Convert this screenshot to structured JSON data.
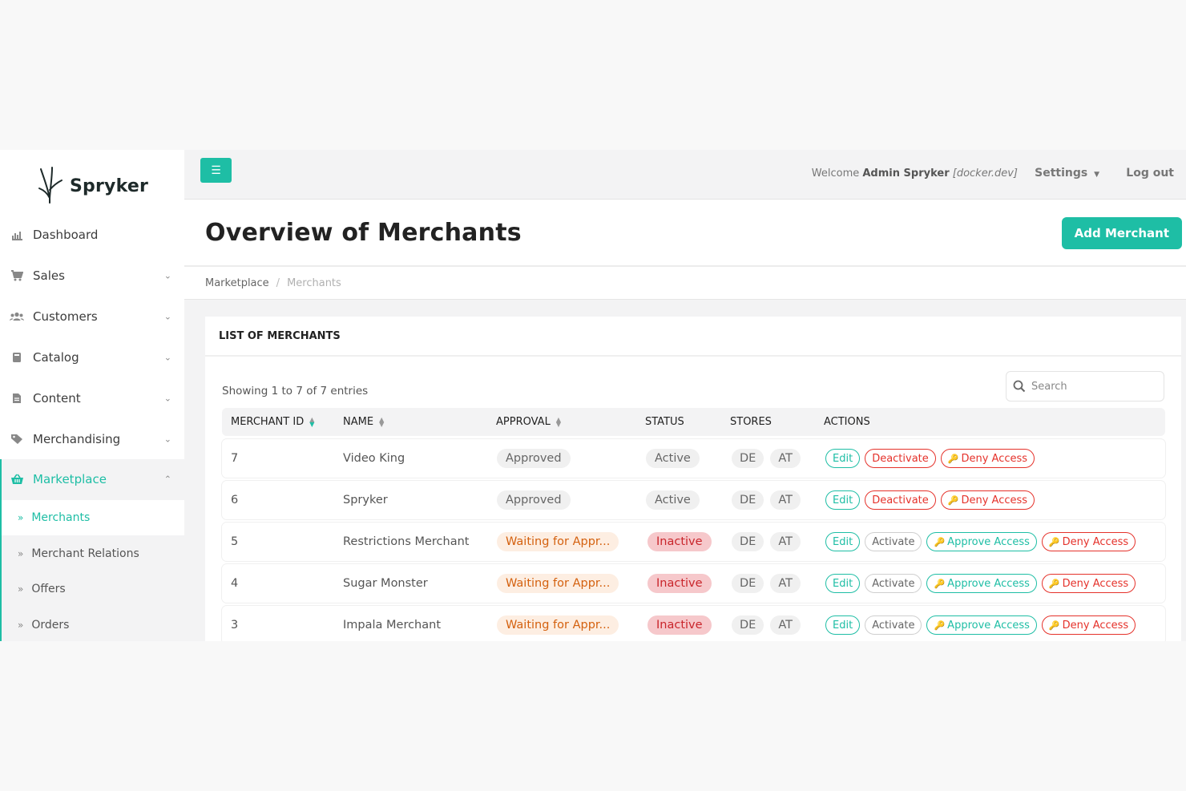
{
  "brand": {
    "name": "Spryker"
  },
  "sidebar": {
    "items": [
      {
        "label": "Dashboard",
        "icon": "chart-icon"
      },
      {
        "label": "Sales",
        "icon": "cart-icon"
      },
      {
        "label": "Customers",
        "icon": "users-icon"
      },
      {
        "label": "Catalog",
        "icon": "book-icon"
      },
      {
        "label": "Content",
        "icon": "file-icon"
      },
      {
        "label": "Merchandising",
        "icon": "tag-icon"
      },
      {
        "label": "Marketplace",
        "icon": "basket-icon"
      }
    ],
    "subitems": [
      {
        "label": "Merchants"
      },
      {
        "label": "Merchant Relations"
      },
      {
        "label": "Offers"
      },
      {
        "label": "Orders"
      }
    ]
  },
  "header": {
    "welcome_prefix": "Welcome",
    "user": "Admin Spryker",
    "env": "[docker.dev]",
    "settings": "Settings",
    "logout": "Log out"
  },
  "page": {
    "title": "Overview of Merchants",
    "add_button": "Add Merchant",
    "breadcrumb": [
      "Marketplace",
      "Merchants"
    ]
  },
  "card": {
    "title": "LIST OF MERCHANTS",
    "showing": "Showing 1 to 7 of 7 entries",
    "search_placeholder": "Search"
  },
  "table": {
    "columns": [
      "MERCHANT ID",
      "NAME",
      "APPROVAL",
      "STATUS",
      "STORES",
      "ACTIONS"
    ],
    "rows": [
      {
        "id": "7",
        "name": "Video King",
        "approval": "Approved",
        "status": "Active",
        "stores": [
          "DE",
          "AT"
        ],
        "actions": [
          "Edit",
          "Deactivate",
          "Deny Access"
        ]
      },
      {
        "id": "6",
        "name": "Spryker",
        "approval": "Approved",
        "status": "Active",
        "stores": [
          "DE",
          "AT"
        ],
        "actions": [
          "Edit",
          "Deactivate",
          "Deny Access"
        ]
      },
      {
        "id": "5",
        "name": "Restrictions Merchant",
        "approval": "Waiting for Appr...",
        "status": "Inactive",
        "stores": [
          "DE",
          "AT"
        ],
        "actions": [
          "Edit",
          "Activate",
          "Approve Access",
          "Deny Access"
        ]
      },
      {
        "id": "4",
        "name": "Sugar Monster",
        "approval": "Waiting for Appr...",
        "status": "Inactive",
        "stores": [
          "DE",
          "AT"
        ],
        "actions": [
          "Edit",
          "Activate",
          "Approve Access",
          "Deny Access"
        ]
      },
      {
        "id": "3",
        "name": "Impala Merchant",
        "approval": "Waiting for Appr...",
        "status": "Inactive",
        "stores": [
          "DE",
          "AT"
        ],
        "actions": [
          "Edit",
          "Activate",
          "Approve Access",
          "Deny Access"
        ]
      }
    ]
  },
  "colors": {
    "accent": "#1ebea5",
    "danger": "#e5322b",
    "warning": "#d4610f"
  }
}
